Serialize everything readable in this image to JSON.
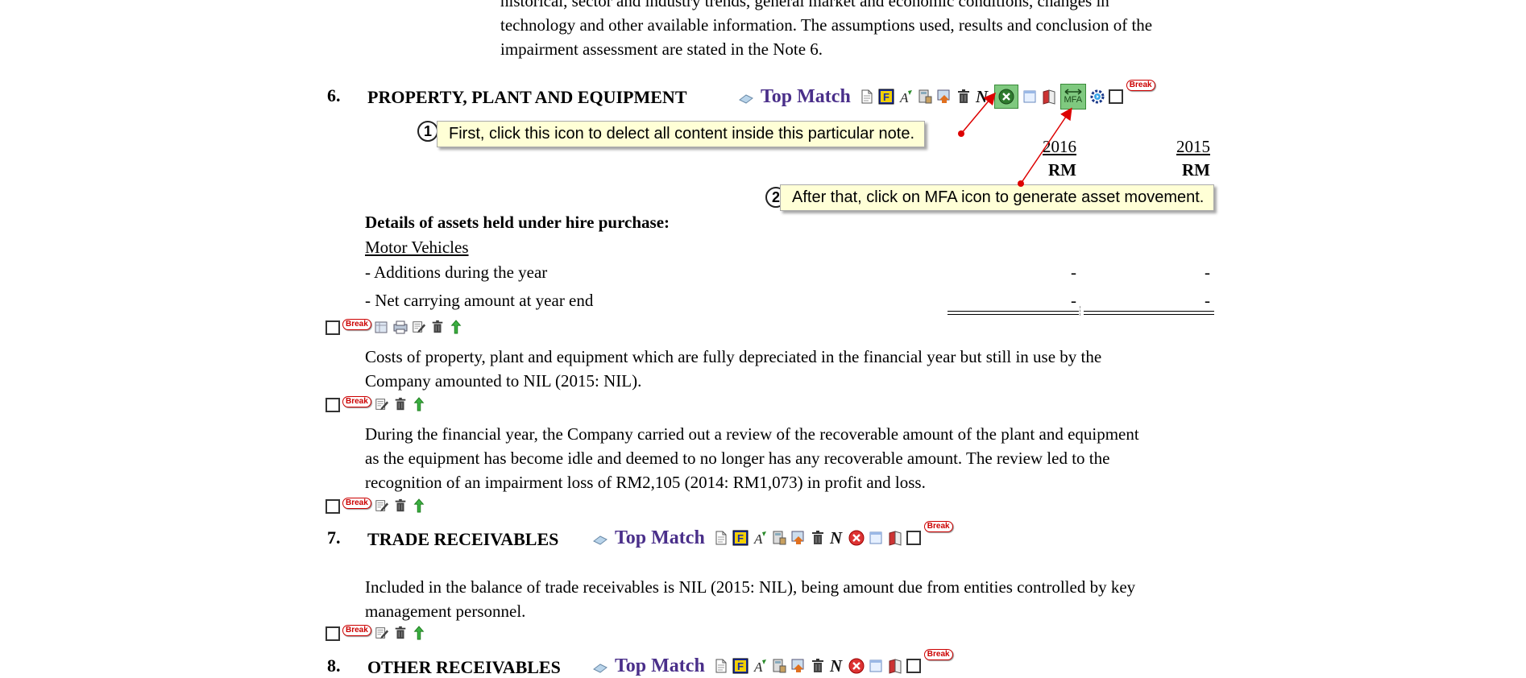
{
  "intro": {
    "line1": "historical, sector and industry trends, general market and economic conditions, changes in",
    "line2": "technology and other available information. The assumptions used, results and conclusion of the",
    "line3": "impairment assessment are stated in the Note 6."
  },
  "note6": {
    "number": "6.",
    "title": "PROPERTY, PLANT AND EQUIPMENT",
    "top_match": "Top Match",
    "mfa_label": "MFA",
    "break_label": "Break",
    "year1": "2016",
    "year2": "2015",
    "unit1": "RM",
    "unit2": "RM",
    "section_heading": "Details of assets held under hire purchase:",
    "sub_heading": "Motor Vehicles",
    "rows": [
      {
        "label": "- Additions during the year",
        "v1": "-",
        "v2": "-"
      },
      {
        "label": "- Net carrying amount at year end",
        "v1": "-",
        "v2": "-"
      }
    ],
    "para1_l1": "Costs of property, plant and equipment which are fully depreciated in the financial year but still in use by the",
    "para1_l2": "Company amounted to NIL (2015: NIL).",
    "para2_l1": "During the financial year, the Company carried out a review of the recoverable amount of the plant and equipment",
    "para2_l2": "as the equipment has become idle and deemed to no longer has any recoverable amount. The review led to the",
    "para2_l3": "recognition of an impairment loss of RM2,105 (2014: RM1,073) in profit and loss."
  },
  "callouts": {
    "c1_num": "1",
    "c1_text": "First, click this icon to delect all content inside this particular note.",
    "c2_num": "2",
    "c2_text": "After that, click on MFA icon to generate asset movement."
  },
  "note7": {
    "number": "7.",
    "title": "TRADE RECEIVABLES",
    "top_match": "Top Match",
    "break_label": "Break",
    "para_l1": "Included in the balance of trade receivables is NIL (2015: NIL), being amount due from entities controlled by key",
    "para_l2": "management personnel."
  },
  "note8": {
    "number": "8.",
    "title": "OTHER RECEIVABLES",
    "top_match": "Top Match",
    "break_label": "Break"
  },
  "colors": {
    "top_match": "#4a2f8a",
    "callout_bg": "#ffffd6",
    "break_red": "#cc0000",
    "arrow_red": "#dd0000",
    "mfa_green": "#7fc97f"
  }
}
